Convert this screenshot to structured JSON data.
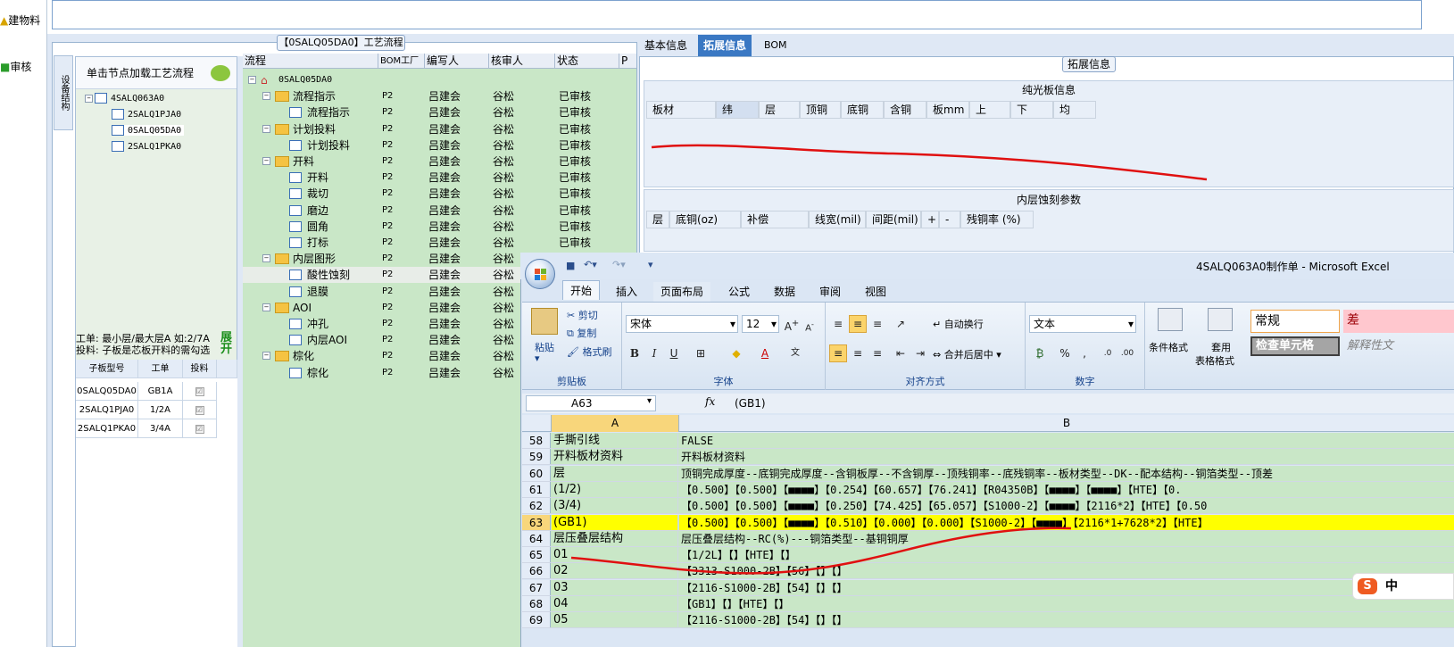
{
  "left_strip": {
    "item1": "建物料",
    "item2": "审核"
  },
  "process_panel": {
    "title": "【0SALQ05DA0】工艺流程",
    "vertical_tab": "设备结构",
    "tip": "单击节点加载工艺流程",
    "tree": [
      "4SALQ063A0",
      "2SALQ1PJA0",
      "0SALQ05DA0",
      "2SALQ1PKA0"
    ],
    "info_line1": "工单: 最小层/最大层A 如:2/7A",
    "info_line2": "投料: 子板是芯板开料的需勾选",
    "expand_label": "展开",
    "subgrid": {
      "headers": [
        "子板型号",
        "工单",
        "投料"
      ],
      "rows": [
        {
          "model": "0SALQ05DA0",
          "order": "GB1A",
          "check": "☑"
        },
        {
          "model": "2SALQ1PJA0",
          "order": "1/2A",
          "check": "☑"
        },
        {
          "model": "2SALQ1PKA0",
          "order": "3/4A",
          "check": "☑"
        }
      ]
    }
  },
  "flow_grid": {
    "headers": [
      "流程",
      "BOM工厂",
      "编写人",
      "核审人",
      "状态",
      "P"
    ],
    "rows": [
      {
        "name": "0SALQ05DA0",
        "factory": "",
        "writer": "",
        "reviewer": "",
        "status": ""
      },
      {
        "name": "流程指示",
        "factory": "P2",
        "writer": "吕建会",
        "reviewer": "谷松",
        "status": "已审核"
      },
      {
        "name": "流程指示",
        "factory": "P2",
        "writer": "吕建会",
        "reviewer": "谷松",
        "status": "已审核"
      },
      {
        "name": "计划投料",
        "factory": "P2",
        "writer": "吕建会",
        "reviewer": "谷松",
        "status": "已审核"
      },
      {
        "name": "计划投料",
        "factory": "P2",
        "writer": "吕建会",
        "reviewer": "谷松",
        "status": "已审核"
      },
      {
        "name": "开料",
        "factory": "P2",
        "writer": "吕建会",
        "reviewer": "谷松",
        "status": "已审核"
      },
      {
        "name": "开料",
        "factory": "P2",
        "writer": "吕建会",
        "reviewer": "谷松",
        "status": "已审核"
      },
      {
        "name": "裁切",
        "factory": "P2",
        "writer": "吕建会",
        "reviewer": "谷松",
        "status": "已审核"
      },
      {
        "name": "磨边",
        "factory": "P2",
        "writer": "吕建会",
        "reviewer": "谷松",
        "status": "已审核"
      },
      {
        "name": "圆角",
        "factory": "P2",
        "writer": "吕建会",
        "reviewer": "谷松",
        "status": "已审核"
      },
      {
        "name": "打标",
        "factory": "P2",
        "writer": "吕建会",
        "reviewer": "谷松",
        "status": "已审核"
      },
      {
        "name": "内层图形",
        "factory": "P2",
        "writer": "吕建会",
        "reviewer": "谷松",
        "status": "已审核"
      },
      {
        "name": "酸性蚀刻",
        "factory": "P2",
        "writer": "吕建会",
        "reviewer": "谷松",
        "status": ""
      },
      {
        "name": "退膜",
        "factory": "P2",
        "writer": "吕建会",
        "reviewer": "谷松",
        "status": ""
      },
      {
        "name": "AOI",
        "factory": "P2",
        "writer": "吕建会",
        "reviewer": "谷松",
        "status": ""
      },
      {
        "name": "冲孔",
        "factory": "P2",
        "writer": "吕建会",
        "reviewer": "谷松",
        "status": ""
      },
      {
        "name": "内层AOI",
        "factory": "P2",
        "writer": "吕建会",
        "reviewer": "谷松",
        "status": ""
      },
      {
        "name": "棕化",
        "factory": "P2",
        "writer": "吕建会",
        "reviewer": "谷松",
        "status": ""
      },
      {
        "name": "棕化",
        "factory": "P2",
        "writer": "吕建会",
        "reviewer": "谷松",
        "status": ""
      }
    ]
  },
  "right_panel": {
    "tabs": [
      "基本信息",
      "拓展信息",
      "BOM"
    ],
    "group_title": "拓展信息",
    "section1_title": "纯光板信息",
    "section1_cols": [
      "板材",
      "纬",
      "层",
      "顶铜",
      "底铜",
      "含铜",
      "板mm",
      "上",
      "下",
      "均"
    ],
    "section2_title": "内层蚀刻参数",
    "section2_cols": [
      "层",
      "底铜(oz)",
      "补偿",
      "线宽(mil)",
      "间距(mil)",
      "+",
      "-",
      "残铜率 (%)"
    ]
  },
  "excel": {
    "title": "4SALQ063A0制作单 - Microsoft Excel",
    "tabs": [
      "开始",
      "插入",
      "页面布局",
      "公式",
      "数据",
      "审阅",
      "视图"
    ],
    "clipboard": {
      "paste": "粘贴",
      "cut": "剪切",
      "copy": "复制",
      "format_painter": "格式刷",
      "label": "剪贴板"
    },
    "font": {
      "name": "宋体",
      "size": "12",
      "label": "字体"
    },
    "alignment": {
      "wrap": "自动换行",
      "merge": "合并后居中",
      "label": "对齐方式"
    },
    "number": {
      "format": "文本",
      "label": "数字"
    },
    "styles": {
      "cond": "条件格式",
      "table1": "套用",
      "table2": "表格格式",
      "normal": "常规",
      "bad": "差",
      "check": "检查单元格",
      "note": "解释性文"
    },
    "name_box": "A63",
    "fx": "fx",
    "formula": "(GB1)",
    "col_a": "A",
    "col_b": "B",
    "rows": [
      {
        "n": "58",
        "a": "手撕引线",
        "b": "FALSE"
      },
      {
        "n": "59",
        "a": "开料板材资料",
        "b": "开料板材资料"
      },
      {
        "n": "60",
        "a": "层",
        "b": "顶铜完成厚度--底铜完成厚度--含铜板厚--不含铜厚--顶残铜率--底残铜率--板材类型--DK--配本结构--铜箔类型--顶差"
      },
      {
        "n": "61",
        "a": "(1/2)",
        "b": "【0.500】【0.500】【■■■■】【0.254】【60.657】【76.241】【R04350B】【■■■■】【■■■■】【HTE】【0."
      },
      {
        "n": "62",
        "a": "(3/4)",
        "b": "【0.500】【0.500】【■■■■】【0.250】【74.425】【65.057】【S1000-2】【■■■■】【2116*2】【HTE】【0.50"
      },
      {
        "n": "63",
        "a": "(GB1)",
        "b": "【0.500】【0.500】【■■■■】【0.510】【0.000】【0.000】【S1000-2】【■■■■】【2116*1+7628*2】【HTE】"
      },
      {
        "n": "64",
        "a": "层压叠层结构",
        "b": "层压叠层结构--RC(%)---铜箔类型--基铜铜厚"
      },
      {
        "n": "65",
        "a": "01",
        "b": "【1/2L】【】【HTE】【】"
      },
      {
        "n": "66",
        "a": "02",
        "b": "【3313-S1000-2B】【56】【】【】"
      },
      {
        "n": "67",
        "a": "03",
        "b": "【2116-S1000-2B】【54】【】【】"
      },
      {
        "n": "68",
        "a": "04",
        "b": "【GB1】【】【HTE】【】"
      },
      {
        "n": "69",
        "a": "05",
        "b": "【2116-S1000-2B】【54】【】【】"
      }
    ]
  },
  "sogou_badge": "中",
  "colors": {
    "sheet_green": "#c9e7c7",
    "highlight": "#ffff00",
    "accent": "#3a78c3",
    "annotation": "#e01010"
  }
}
